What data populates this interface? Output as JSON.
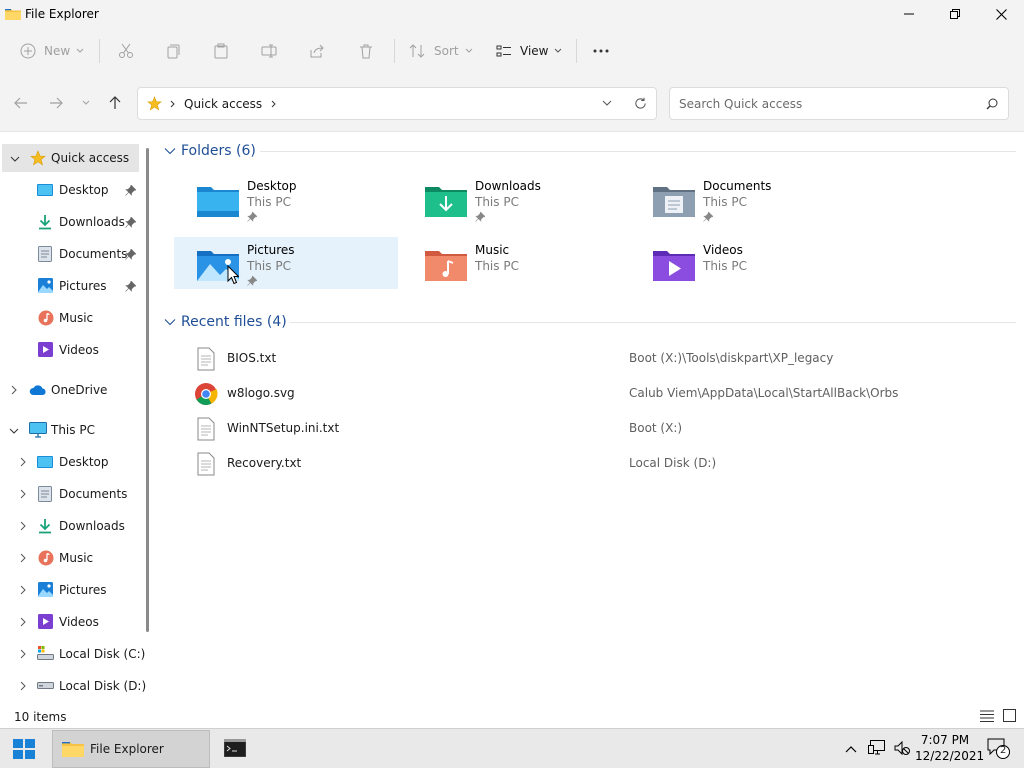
{
  "window": {
    "title": "File Explorer"
  },
  "commandbar": {
    "new_label": "New",
    "sort_label": "Sort",
    "view_label": "View"
  },
  "address": {
    "location": "Quick access"
  },
  "search": {
    "placeholder": "Search Quick access"
  },
  "sidebar": {
    "quick_access": "Quick access",
    "quick_items": [
      {
        "label": "Desktop",
        "icon": "desktop-icon",
        "pinned": true
      },
      {
        "label": "Downloads",
        "icon": "downloads-icon",
        "pinned": true
      },
      {
        "label": "Documents",
        "icon": "documents-icon",
        "pinned": true
      },
      {
        "label": "Pictures",
        "icon": "pictures-icon",
        "pinned": true
      },
      {
        "label": "Music",
        "icon": "music-icon",
        "pinned": false
      },
      {
        "label": "Videos",
        "icon": "videos-icon",
        "pinned": false
      }
    ],
    "onedrive": "OneDrive",
    "this_pc": "This PC",
    "pc_items": [
      {
        "label": "Desktop",
        "icon": "desktop-icon"
      },
      {
        "label": "Documents",
        "icon": "documents-icon"
      },
      {
        "label": "Downloads",
        "icon": "downloads-icon"
      },
      {
        "label": "Music",
        "icon": "music-icon"
      },
      {
        "label": "Pictures",
        "icon": "pictures-icon"
      },
      {
        "label": "Videos",
        "icon": "videos-icon"
      },
      {
        "label": "Local Disk (C:)",
        "icon": "drive-c-icon"
      },
      {
        "label": "Local Disk (D:)",
        "icon": "drive-d-icon"
      }
    ]
  },
  "folders": {
    "header": "Folders (6)",
    "items": [
      {
        "name": "Desktop",
        "location": "This PC",
        "pinned": true
      },
      {
        "name": "Downloads",
        "location": "This PC",
        "pinned": true
      },
      {
        "name": "Documents",
        "location": "This PC",
        "pinned": true
      },
      {
        "name": "Pictures",
        "location": "This PC",
        "pinned": true
      },
      {
        "name": "Music",
        "location": "This PC",
        "pinned": false
      },
      {
        "name": "Videos",
        "location": "This PC",
        "pinned": false
      }
    ]
  },
  "recent": {
    "header": "Recent files (4)",
    "items": [
      {
        "name": "BIOS.txt",
        "path": "Boot (X:)\\Tools\\diskpart\\XP_legacy",
        "icon": "text-file-icon"
      },
      {
        "name": "w8logo.svg",
        "path": "Calub Viem\\AppData\\Local\\StartAllBack\\Orbs",
        "icon": "chrome-icon"
      },
      {
        "name": "WinNTSetup.ini.txt",
        "path": "Boot (X:)",
        "icon": "text-file-icon"
      },
      {
        "name": "Recovery.txt",
        "path": "Local Disk (D:)",
        "icon": "text-file-icon"
      }
    ]
  },
  "status": {
    "item_count": "10 items"
  },
  "taskbar": {
    "active_app": "File Explorer",
    "time": "7:07 PM",
    "date": "12/22/2021",
    "notification_count": "2"
  },
  "colors": {
    "accent": "#0067c0",
    "section_header": "#1f4e96",
    "hover_tile": "#e5f1fb",
    "selected_nav": "#e5e5e5"
  }
}
